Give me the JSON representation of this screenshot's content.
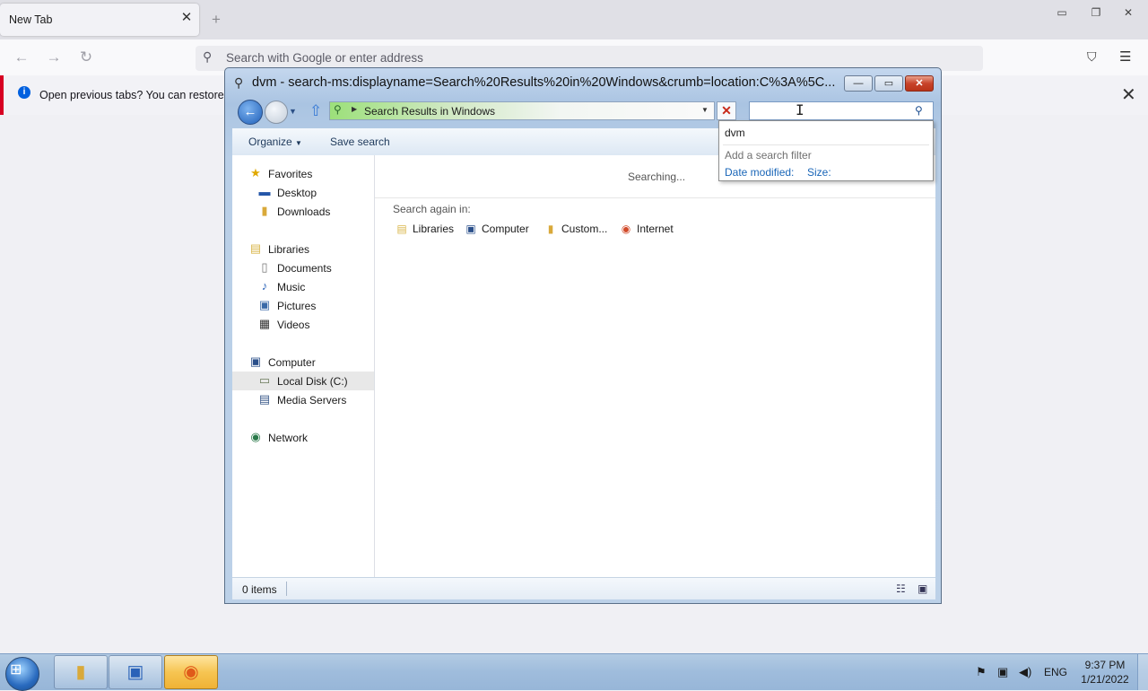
{
  "browser": {
    "tab_title": "New Tab",
    "tab_close": "✕",
    "new_tab": "+",
    "url_placeholder": "Search with Google or enter address",
    "notification": "Open previous tabs? You can restore yo",
    "window_buttons": {
      "minimize": "▭",
      "restore": "❐",
      "close": "✕"
    }
  },
  "explorer": {
    "title": "dvm - search-ms:displayname=Search%20Results%20in%20Windows&crumb=location:C%3A%5C...",
    "caption_buttons": {
      "minimize": "—",
      "maximize": "▭",
      "close": "✕"
    },
    "address": "Search Results in Windows",
    "commands": {
      "organize": "Organize",
      "save_search": "Save search"
    },
    "nav": {
      "favorites": "Favorites",
      "desktop": "Desktop",
      "downloads": "Downloads",
      "libraries": "Libraries",
      "documents": "Documents",
      "music": "Music",
      "pictures": "Pictures",
      "videos": "Videos",
      "computer": "Computer",
      "local_disk": "Local Disk (C:)",
      "media_servers": "Media Servers",
      "network": "Network"
    },
    "results": {
      "status": "Searching...",
      "search_again_label": "Search again in:",
      "locations": [
        "Libraries",
        "Computer",
        "Custom...",
        "Internet"
      ]
    },
    "status_bar": {
      "items": "0 items"
    }
  },
  "search_dropdown": {
    "term": "dvm",
    "add_filter": "Add a search filter",
    "filters": [
      "Date modified:",
      "Size:"
    ]
  },
  "taskbar": {
    "language": "ENG",
    "time": "9:37 PM",
    "date": "1/21/2022"
  },
  "colors": {
    "accent": "#0060df",
    "notification_border": "#d70022",
    "filter_link": "#1a66b8"
  }
}
